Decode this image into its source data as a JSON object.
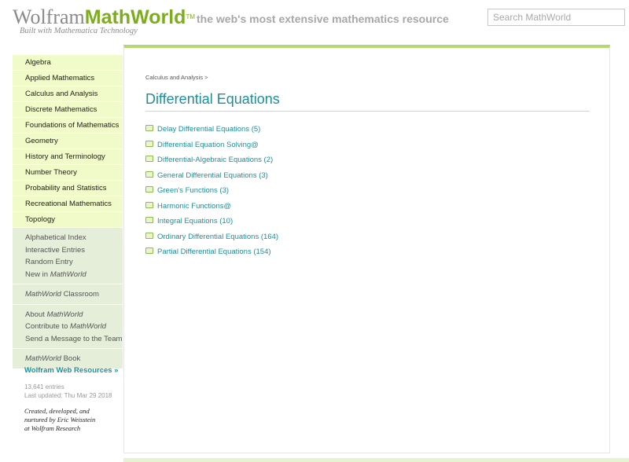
{
  "header": {
    "logo_wolfram": "Wolfram",
    "logo_mathworld": "MathWorld",
    "logo_tm": "TM",
    "tagline": "the web's most extensive mathematics resource",
    "built_with": "Built with Mathematica Technology",
    "search_placeholder": "Search MathWorld"
  },
  "sidebar": {
    "categories": [
      "Algebra",
      "Applied Mathematics",
      "Calculus and Analysis",
      "Discrete Mathematics",
      "Foundations of Mathematics",
      "Geometry",
      "History and Terminology",
      "Number Theory",
      "Probability and Statistics",
      "Recreational Mathematics",
      "Topology"
    ],
    "links": [
      "Alphabetical Index",
      "Interactive Entries",
      "Random Entry",
      "New in ",
      "MathWorld"
    ],
    "classroom_mw": "MathWorld",
    "classroom": " Classroom",
    "about": "About ",
    "about_mw": "MathWorld",
    "contribute": "Contribute to ",
    "contribute_mw": "MathWorld",
    "send_message": "Send a Message to the Team",
    "book_mw": "MathWorld",
    "book": " Book",
    "wolfram_web_resources": "Wolfram Web Resources »",
    "entries": "13,641 entries",
    "last_updated": "Last updated: Thu Mar 29 2018",
    "credit_1": "Created, developed, and",
    "credit_2": "nurtured by Eric Weisstein",
    "credit_3": "at Wolfram Research"
  },
  "main": {
    "breadcrumb": "Calculus and Analysis",
    "breadcrumb_sep": ">",
    "title": "Differential Equations",
    "topics": [
      "Delay Differential Equations (5)",
      "Differential Equation Solving@",
      "Differential-Algebraic Equations (2)",
      "General Differential Equations (3)",
      "Green's Functions (3)",
      "Harmonic Functions@",
      "Integral Equations (10)",
      "Ordinary Differential Equations (164)",
      "Partial Differential Equations (154)"
    ]
  }
}
